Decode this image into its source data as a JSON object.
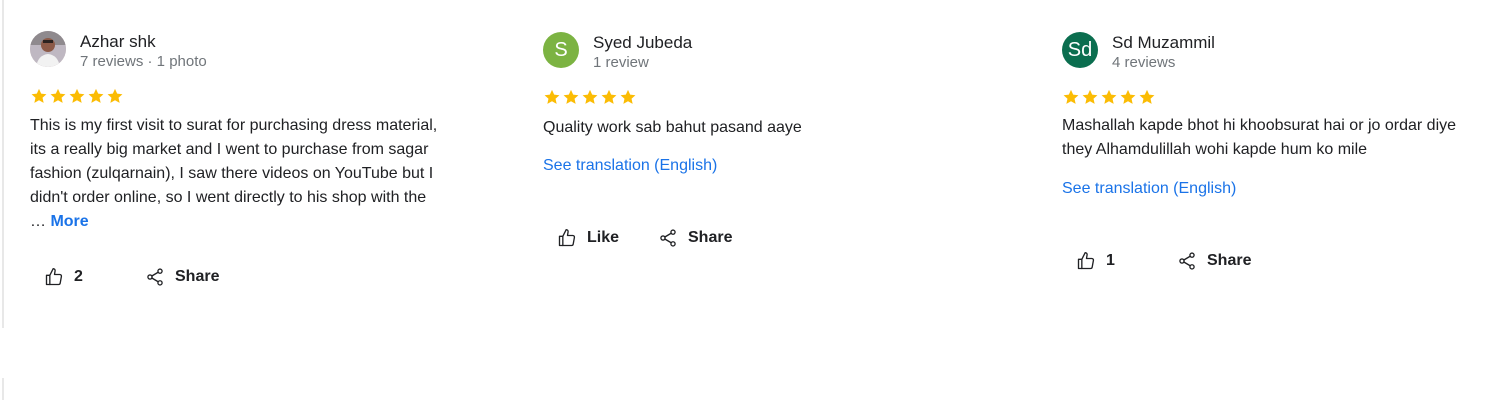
{
  "reviews": [
    {
      "author": "Azhar shk",
      "meta": "7 reviews · 1 photo",
      "avatar_initials": "",
      "avatar_color": "#c9a7a0",
      "rating": 5,
      "text": "This is my first visit to surat for purchasing dress material, its a really big market and I went to purchase from sagar fashion (zulqarnain), I saw there videos on YouTube but I didn't order online, so I went directly to his shop with the … ",
      "more_label": "More",
      "like_label": "2",
      "share_label": "Share"
    },
    {
      "author": "Syed Jubeda",
      "meta": "1 review",
      "avatar_initials": "S",
      "avatar_color": "#7cb342",
      "rating": 5,
      "text": "Quality work sab bahut pasand aaye",
      "translation_label": "See translation (English)",
      "like_label": "Like",
      "share_label": "Share"
    },
    {
      "author": "Sd Muzammil",
      "meta": "4 reviews",
      "avatar_initials": "Sd",
      "avatar_color": "#0b6e4f",
      "rating": 5,
      "text": "Mashallah kapde bhot hi khoobsurat hai or jo ordar diye they Alhamdulillah wohi kapde hum ko mile",
      "translation_label": "See translation (English)",
      "like_label": "1",
      "share_label": "Share"
    }
  ],
  "icons": {
    "star": "star-icon",
    "like": "thumbs-up-icon",
    "share": "share-icon"
  },
  "colors": {
    "star": "#fbbc04",
    "link": "#1a73e8",
    "secondary_text": "#70757a"
  }
}
